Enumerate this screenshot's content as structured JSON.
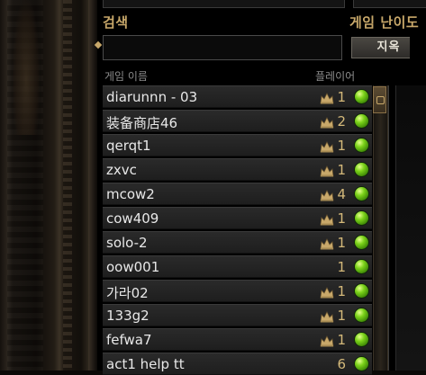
{
  "header": {
    "search_label": "검색",
    "difficulty_label": "게임 난이도",
    "difficulty_value": "지옥",
    "search_value": ""
  },
  "columns": {
    "game_name": "게임 이름",
    "players": "플레이어"
  },
  "games": [
    {
      "name": "diarunnn - 03",
      "players": "1",
      "locked": true
    },
    {
      "name": "装备商店46",
      "players": "2",
      "locked": true
    },
    {
      "name": "qerqt1",
      "players": "1",
      "locked": true
    },
    {
      "name": "zxvc",
      "players": "1",
      "locked": true
    },
    {
      "name": "mcow2",
      "players": "4",
      "locked": true
    },
    {
      "name": "cow409",
      "players": "1",
      "locked": true
    },
    {
      "name": "solo-2",
      "players": "1",
      "locked": true
    },
    {
      "name": "oow001",
      "players": "1",
      "locked": false
    },
    {
      "name": "가라02",
      "players": "1",
      "locked": true
    },
    {
      "name": "133g2",
      "players": "1",
      "locked": true
    },
    {
      "name": "fefwa7",
      "players": "1",
      "locked": true
    },
    {
      "name": "act1 help tt",
      "players": "6",
      "locked": false
    }
  ],
  "icons": {
    "crown": "crown-icon",
    "status": "status-orb-icon"
  },
  "colors": {
    "accent_gold": "#c8a86a",
    "status_green": "#7bd21a"
  }
}
